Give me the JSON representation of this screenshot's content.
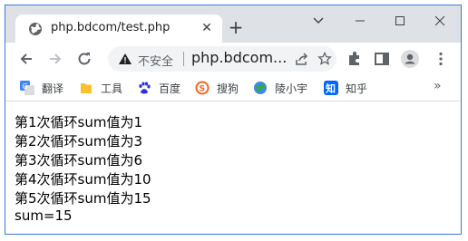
{
  "tab": {
    "title": "php.bdcom/test.php",
    "close_glyph": "✕",
    "new_tab_glyph": "+"
  },
  "window": {
    "minimize_glyph": "—",
    "maximize_glyph": "☐",
    "close_glyph": "✕",
    "chevron_glyph": "⌄"
  },
  "address": {
    "security_label": "不安全",
    "url": "php.bdcom..."
  },
  "bookmarks": [
    {
      "label": "翻译",
      "icon": "translate-icon",
      "color": "#4285f4"
    },
    {
      "label": "工具",
      "icon": "folder-icon",
      "color": "#fbc02d"
    },
    {
      "label": "百度",
      "icon": "baidu-paw-icon",
      "color": "#2932e1"
    },
    {
      "label": "搜狗",
      "icon": "sogou-icon",
      "color": "#f26522"
    },
    {
      "label": "陵小宇",
      "icon": "globe-icon",
      "color": "#4285f4"
    },
    {
      "label": "知乎",
      "icon": "zhihu-icon",
      "color": "#0066ff"
    }
  ],
  "bookmarks_more": "»",
  "output": [
    "第1次循环sum值为1",
    "第2次循环sum值为3",
    "第3次循环sum值为6",
    "第4次循环sum值为10",
    "第5次循环sum值为15",
    "sum=15"
  ],
  "colors": {
    "frame_border": "#3c78d8",
    "tabstrip": "#dee1e6"
  }
}
